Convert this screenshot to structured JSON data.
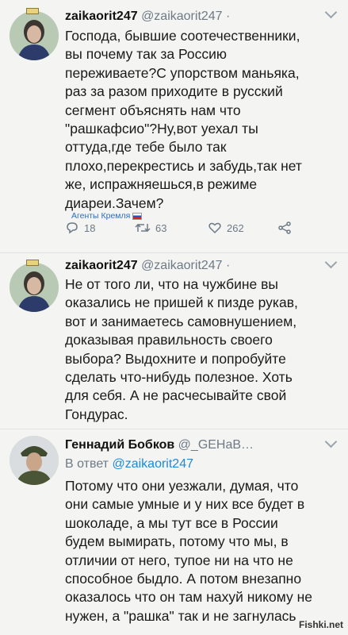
{
  "tweets": [
    {
      "name": "zaikaorit247",
      "handle": "@zaikaorit247 ·",
      "text": "Господа, бывшие соотечественники,\nвы почему так за Россию\nпереживаете?С упорством маньяка,\nраз за разом приходите в русский\nсегмент объяснять нам что\n\"рашкафсио\"?Ну,вот уехал ты\nоттуда,где тебе было так\nплохо,перекрестись и забудь,так нет\nже, испражняешься,в режиме\nдиареи.Зачем?",
      "tag": "Агенты Кремля",
      "actions": {
        "reply_count": "18",
        "retweet_count": "63",
        "like_count": "262"
      }
    },
    {
      "name": "zaikaorit247",
      "handle": "@zaikaorit247 ·",
      "text": "Не от того ли, что на чужбине вы\nоказались не пришей к пизде рукав,\nвот и занимаетесь самовнушением,\nдоказывая правильность своего\nвыбора? Выдохните и попробуйте\nсделать что-нибудь полезное. Хоть\nдля себя. А не расчесывайте свой\nГондурас."
    },
    {
      "name": "Геннадий Бобков",
      "handle": "@_GEHaB…",
      "reply_prefix": "В ответ",
      "reply_to": "@zaikaorit247",
      "text": "Потому что они уезжали, думая, что\nони самые умные и у них все будет в\nшоколаде, а мы тут все в России\nбудем вымирать, потому что мы, в\nотличии от него, тупое ни на что не\nспособное быдло. А потом внезапно\nоказалось что он там нахуй никому не\nнужен, а \"рашка\" так и не загнулась"
    }
  ],
  "watermark": "Fishki.net",
  "icons": {
    "reply": "reply-icon",
    "retweet": "retweet-icon",
    "like": "heart-icon",
    "share": "share-icon",
    "more": "chevron-down-icon"
  }
}
